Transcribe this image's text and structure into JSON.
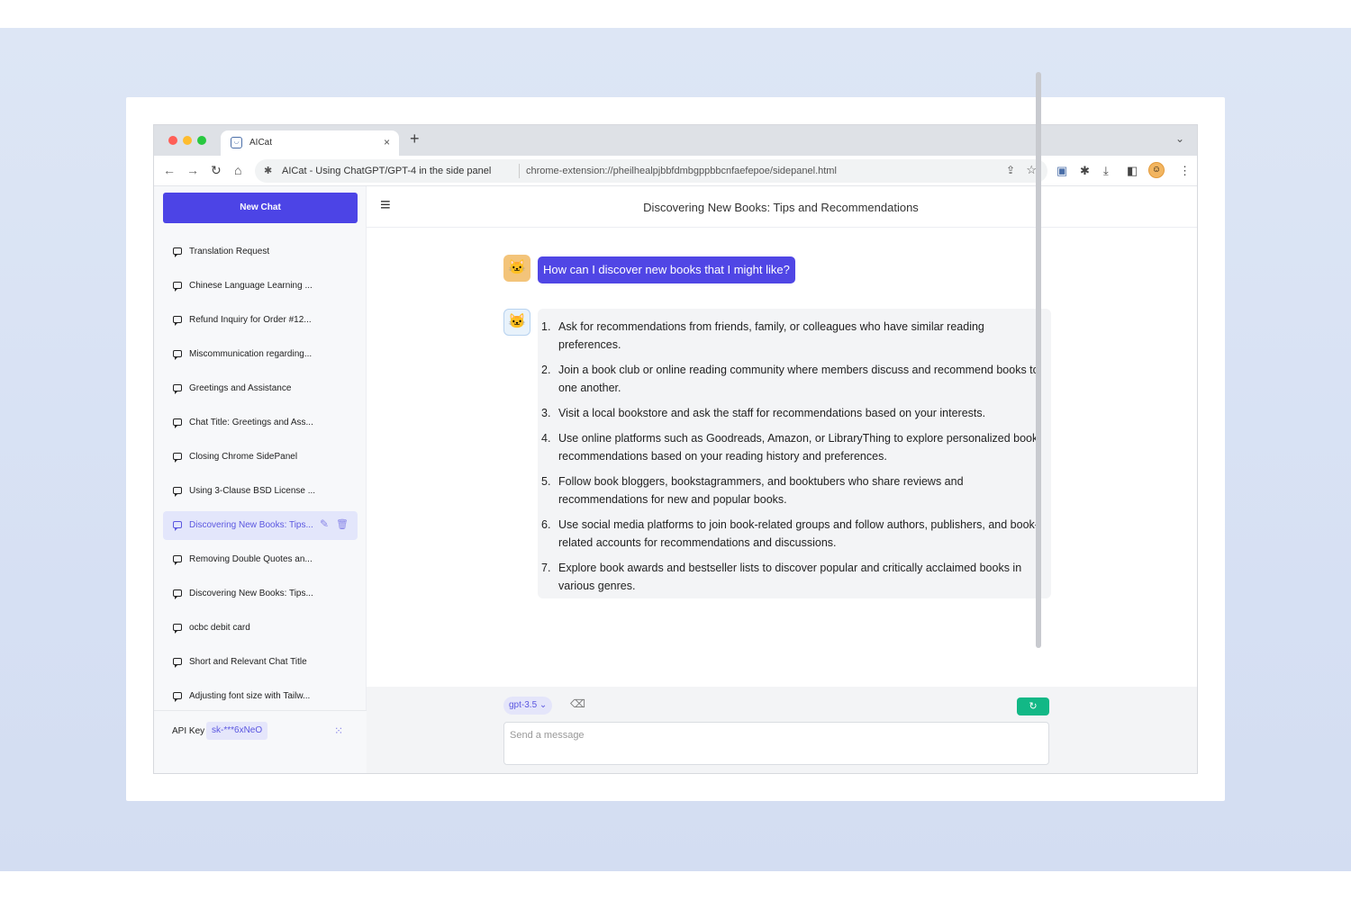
{
  "browser": {
    "tab_title": "AICat",
    "tab_close": "×",
    "new_tab": "+",
    "site_name": "AICat - Using ChatGPT/GPT-4 in the side panel",
    "url": "chrome-extension://pheilhealpjbbfdmbgppbbcnfaefepoe/sidepanel.html"
  },
  "sidebar": {
    "new_chat_label": "New Chat",
    "items": [
      {
        "label": "Translation Request"
      },
      {
        "label": "Chinese Language Learning ..."
      },
      {
        "label": "Refund Inquiry for Order #12..."
      },
      {
        "label": "Miscommunication regarding..."
      },
      {
        "label": "Greetings and Assistance"
      },
      {
        "label": "Chat Title: Greetings and Ass..."
      },
      {
        "label": "Closing Chrome SidePanel"
      },
      {
        "label": "Using 3-Clause BSD License ..."
      },
      {
        "label": "Discovering New Books: Tips..."
      },
      {
        "label": "Removing Double Quotes an..."
      },
      {
        "label": "Discovering New Books: Tips..."
      },
      {
        "label": "ocbc debit card"
      },
      {
        "label": "Short and Relevant Chat Title"
      },
      {
        "label": "Adjusting font size with Tailw..."
      }
    ],
    "api_key_label": "API Key",
    "api_key_value": "sk-***6xNeO"
  },
  "chat": {
    "title": "Discovering New Books: Tips and Recommendations",
    "user_message": "How can I discover new books that I might like?",
    "assistant_items": [
      {
        "num": "1.",
        "text": "Ask for recommendations from friends, family, or colleagues who have similar reading preferences."
      },
      {
        "num": "2.",
        "text": "Join a book club or online reading community where members discuss and recommend books to one another."
      },
      {
        "num": "3.",
        "text": "Visit a local bookstore and ask the staff for recommendations based on your interests."
      },
      {
        "num": "4.",
        "text": "Use online platforms such as Goodreads, Amazon, or LibraryThing to explore personalized book recommendations based on your reading history and preferences."
      },
      {
        "num": "5.",
        "text": "Follow book bloggers, bookstagrammers, and booktubers who share reviews and recommendations for new and popular books."
      },
      {
        "num": "6.",
        "text": "Use social media platforms to join book-related groups and follow authors, publishers, and book-related accounts for recommendations and discussions."
      },
      {
        "num": "7.",
        "text": "Explore book awards and bestseller lists to discover popular and critically acclaimed books in various genres."
      }
    ]
  },
  "composer": {
    "model_label": "gpt-3.5 ⌄",
    "input_placeholder": "Send a message",
    "input_value": ""
  },
  "colors": {
    "accent": "#4c44e6",
    "send_button": "#12b886"
  }
}
